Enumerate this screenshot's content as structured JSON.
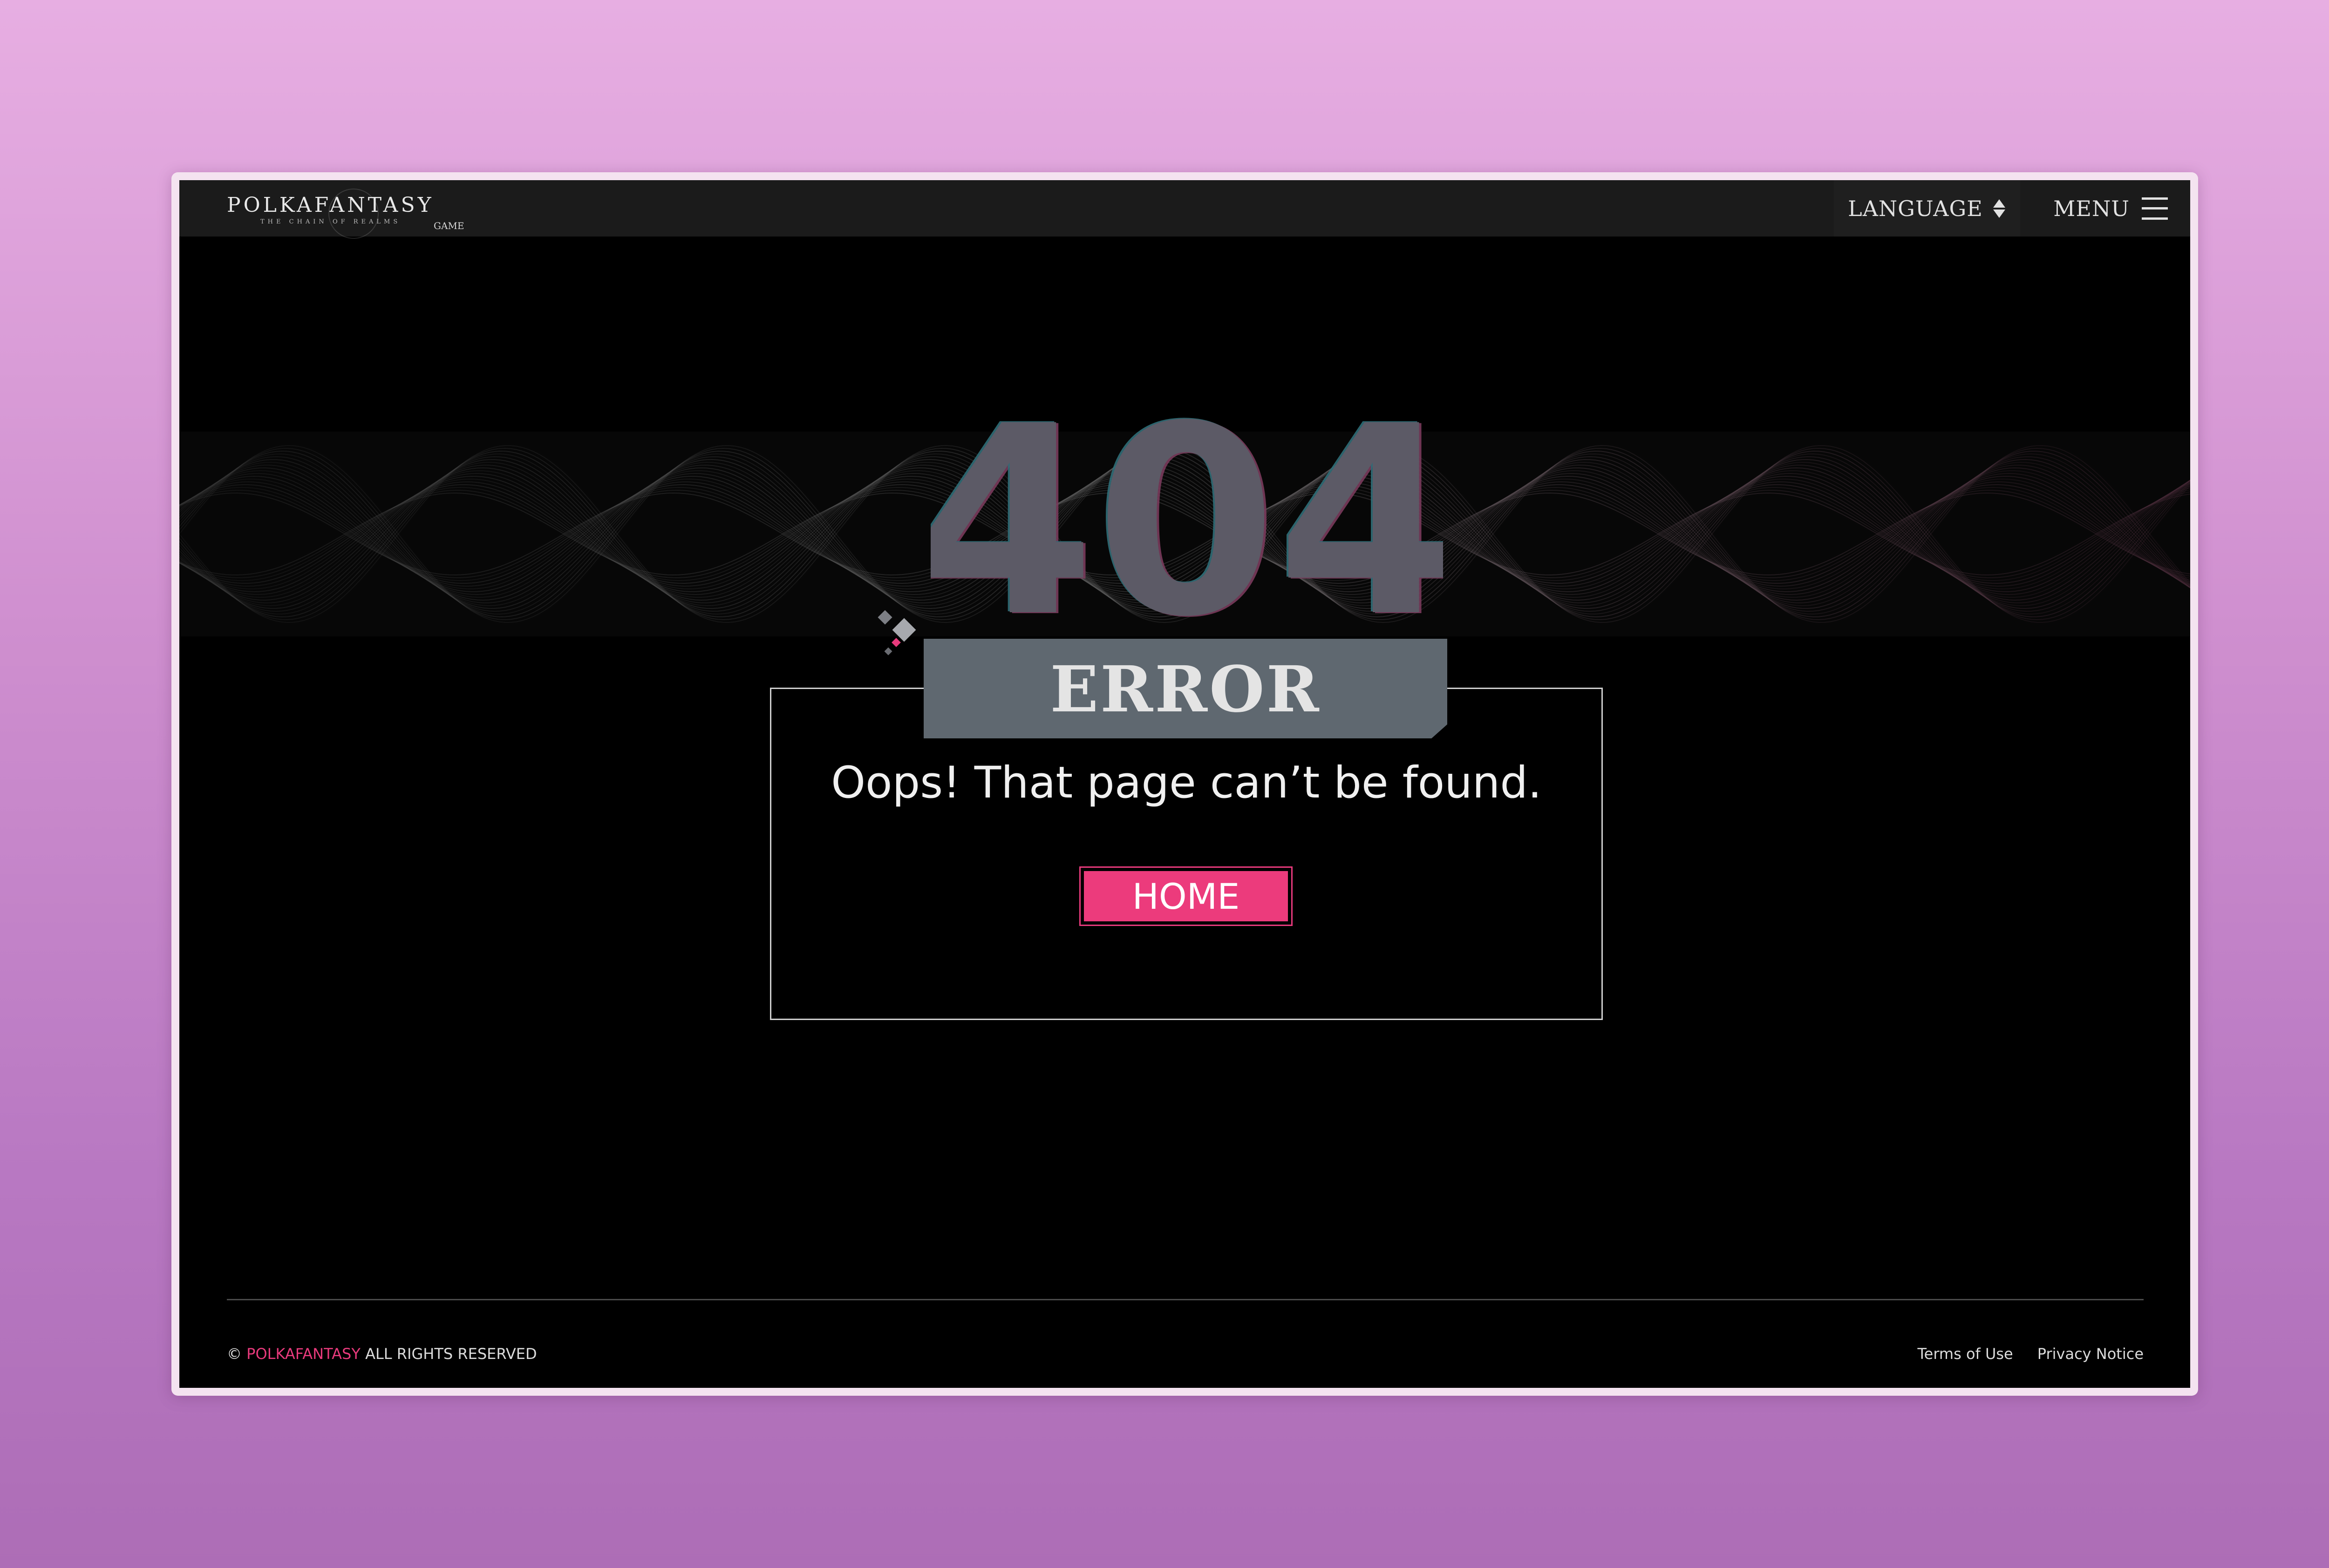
{
  "header": {
    "logo_main": "POLKAFANTASY",
    "logo_sub": "THE CHAIN OF REALMS",
    "logo_game": "GAME",
    "language_label": "LANGUAGE",
    "language_icon": "sort-arrows-icon",
    "menu_label": "MENU",
    "menu_icon": "hamburger-icon"
  },
  "main": {
    "code": "404",
    "banner": "ERROR",
    "message": "Oops! That page can’t be found.",
    "home_button": "HOME"
  },
  "footer": {
    "copyright_symbol": "©",
    "brand": "POLKAFANTASY",
    "rights": "ALL RIGHTS RESERVED",
    "links": [
      "Terms of Use",
      "Privacy Notice"
    ]
  },
  "colors": {
    "accent": "#ec3b7c",
    "banner": "#5f6870",
    "background": "#000000",
    "topbar": "#1b1b1b"
  }
}
